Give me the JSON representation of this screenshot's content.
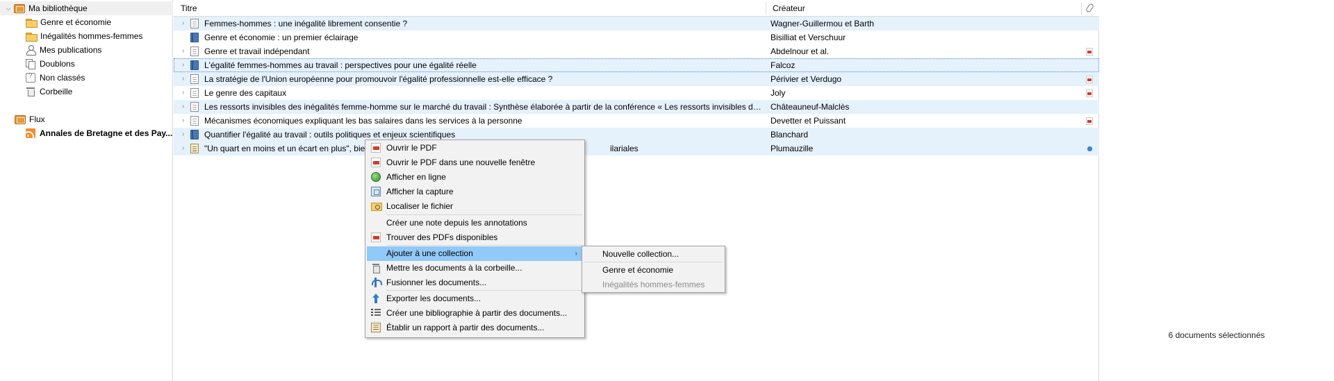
{
  "collections": {
    "library": {
      "label": "Ma bibliothèque",
      "icon": "library-icon"
    },
    "items": [
      {
        "label": "Genre et économie",
        "icon": "folder-icon"
      },
      {
        "label": "Inégalités hommes-femmes",
        "icon": "folder-icon"
      },
      {
        "label": "Mes publications",
        "icon": "user-icon"
      },
      {
        "label": "Doublons",
        "icon": "duplicates-icon"
      },
      {
        "label": "Non classés",
        "icon": "unfiled-icon"
      },
      {
        "label": "Corbeille",
        "icon": "trash-icon"
      }
    ],
    "feeds": {
      "label": "Flux",
      "icon": "library-icon"
    },
    "feed_item": {
      "label": "Annales de Bretagne et des Pay...",
      "icon": "rss-icon"
    }
  },
  "columns": {
    "title": "Titre",
    "creator": "Créateur",
    "attachments_icon": "paperclip-icon"
  },
  "items": [
    {
      "title": "Femmes-hommes : une inégalité librement consentie ?",
      "creator": "Wagner-Guillermou et Barth",
      "type": "document",
      "selected": true,
      "has_children": true,
      "attachment": ""
    },
    {
      "title": "Genre et économie : un premier éclairage",
      "creator": "Bisilliat et Verschuur",
      "type": "book",
      "selected": false,
      "has_children": false,
      "attachment": ""
    },
    {
      "title": "Genre et travail indépendant",
      "creator": "Abdelnour et al.",
      "type": "document",
      "selected": false,
      "has_children": true,
      "attachment": "pdf"
    },
    {
      "title": "L'égalité femmes-hommes au travail : perspectives pour une égalité réelle",
      "creator": "Falcoz",
      "type": "book",
      "selected": true,
      "focused": true,
      "has_children": true,
      "attachment": ""
    },
    {
      "title": "La stratégie de l'Union européenne pour promouvoir l'égalité professionnelle est-elle efficace ?",
      "creator": "Périvier et Verdugo",
      "type": "document",
      "selected": true,
      "has_children": true,
      "attachment": "pdf"
    },
    {
      "title": "Le genre des capitaux",
      "creator": "Joly",
      "type": "document",
      "selected": false,
      "has_children": true,
      "attachment": "pdf"
    },
    {
      "title": "Les ressorts invisibles des inégalités femme-homme sur le marché du travail : Synthèse élaborée à partir de la conférence « Les ressorts invisibles des in...",
      "creator": "Châteauneuf-Malclès",
      "type": "document",
      "selected": true,
      "has_children": true,
      "attachment": ""
    },
    {
      "title": "Mécanismes économiques expliquant les bas salaires dans les services à la personne",
      "creator": "Devetter et Puissant",
      "type": "document",
      "selected": false,
      "has_children": true,
      "attachment": "pdf"
    },
    {
      "title": "Quantifier l'égalité au travail : outils politiques et enjeux scientifiques",
      "creator": "Blanchard",
      "type": "book",
      "selected": true,
      "has_children": true,
      "attachment": ""
    },
    {
      "title": "\"Un quart en moins et un écart en plus\", bie",
      "title_tail": "ilariales",
      "creator": "Plumauzille",
      "type": "report",
      "selected": true,
      "has_children": true,
      "attachment": "link"
    }
  ],
  "status": {
    "selection": "6 documents sélectionnés"
  },
  "context_menu": {
    "items": [
      {
        "label": "Ouvrir le PDF",
        "icon": "pdf-icon"
      },
      {
        "label": "Ouvrir le PDF dans une nouvelle fenêtre",
        "icon": "pdf-icon"
      },
      {
        "label": "Afficher en ligne",
        "icon": "globe-icon"
      },
      {
        "label": "Afficher la capture",
        "icon": "snapshot-icon"
      },
      {
        "label": "Localiser le fichier",
        "icon": "locate-file-icon"
      },
      {
        "label": "Créer une note depuis les annotations",
        "icon": ""
      },
      {
        "label": "Trouver des PDFs disponibles",
        "icon": "pdf-icon"
      },
      {
        "label": "Ajouter à une collection",
        "icon": "",
        "highlighted": true,
        "submenu": true
      },
      {
        "label": "Mettre les documents à la corbeille...",
        "icon": "trash-icon"
      },
      {
        "label": "Fusionner les documents...",
        "icon": "merge-icon"
      },
      {
        "label": "Exporter les documents...",
        "icon": "export-icon"
      },
      {
        "label": "Créer une bibliographie à partir des documents...",
        "icon": "bibliography-icon"
      },
      {
        "label": "Établir un rapport à partir des documents...",
        "icon": "report-icon"
      }
    ]
  },
  "submenu": {
    "items": [
      {
        "label": "Nouvelle collection...",
        "disabled": false
      },
      {
        "label": "Genre et économie",
        "disabled": false
      },
      {
        "label": "Inégalités hommes-femmes",
        "disabled": true
      }
    ]
  },
  "colors": {
    "selection_bg": "#e5f1fb",
    "menu_highlight": "#91c9f7",
    "menu_bg": "#f2f2f2",
    "folder": "#f5cf6a",
    "pdf_red": "#d33a2c"
  }
}
